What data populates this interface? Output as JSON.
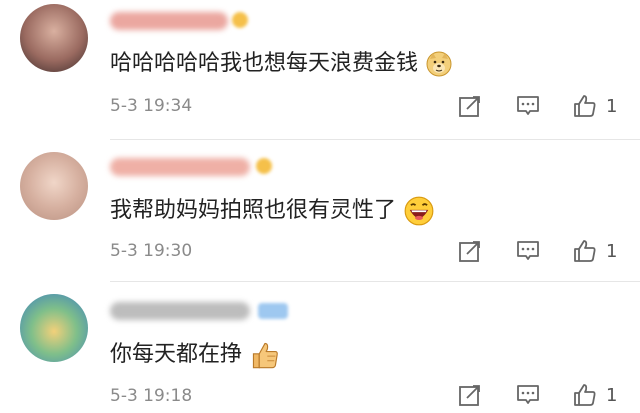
{
  "comments": [
    {
      "text": "哈哈哈哈哈我也想每天浪费金钱",
      "emoji": "doge-emoji",
      "time": "5-3 19:34",
      "likes": "1",
      "name_color": "#e8a29a"
    },
    {
      "text": "我帮助妈妈拍照也很有灵性了",
      "emoji": "laughing-emoji",
      "time": "5-3 19:30",
      "likes": "1",
      "name_color": "#e8a29a"
    },
    {
      "text": "你每天都在挣",
      "emoji": "thumbs-up-emoji",
      "time": "5-3 19:18",
      "likes": "1",
      "name_color": "#b9b9b9"
    }
  ],
  "icons": {
    "share": "share-icon",
    "reply": "comment-icon",
    "like": "thumbs-up-icon"
  },
  "colors": {
    "text": "#222222",
    "meta": "#8a8a8a",
    "icon": "#666666",
    "badge": "#f5b942"
  }
}
